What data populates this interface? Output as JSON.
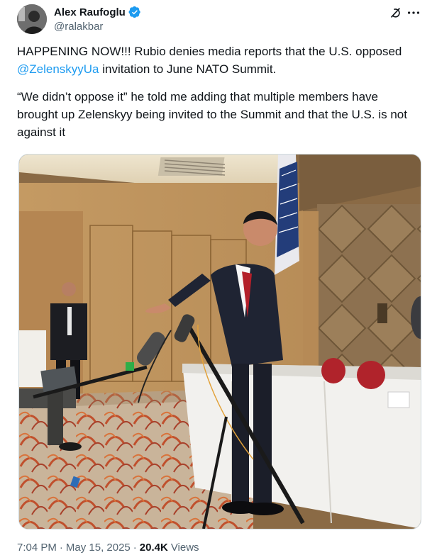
{
  "author": {
    "display_name": "Alex Raufoglu",
    "handle": "@ralakbar",
    "verified": true,
    "avatar_icon": "avatar-photo"
  },
  "header_icons": [
    "grok-icon",
    "more-icon"
  ],
  "body": {
    "line1_prefix": "HAPPENING NOW!!!  Rubio denies media reports that the U.S. opposed ",
    "mention": "@ZelenskyyUa",
    "line1_suffix": " invitation to June NATO Summit.",
    "paragraph2": "“We didn’t oppose it” he told me adding that multiple members have brought up Zelenskyy being invited to the Summit and that the U.S. is not against it"
  },
  "media": {
    "type": "photo"
  },
  "footer": {
    "time": "7:04 PM",
    "separator": "·",
    "date": "May 15, 2025",
    "views_count": "20.4K",
    "views_label": "Views"
  },
  "colors": {
    "link": "#1d9bf0",
    "verified": "#1d9bf0",
    "secondary_text": "#536471",
    "primary_text": "#0f1419"
  }
}
